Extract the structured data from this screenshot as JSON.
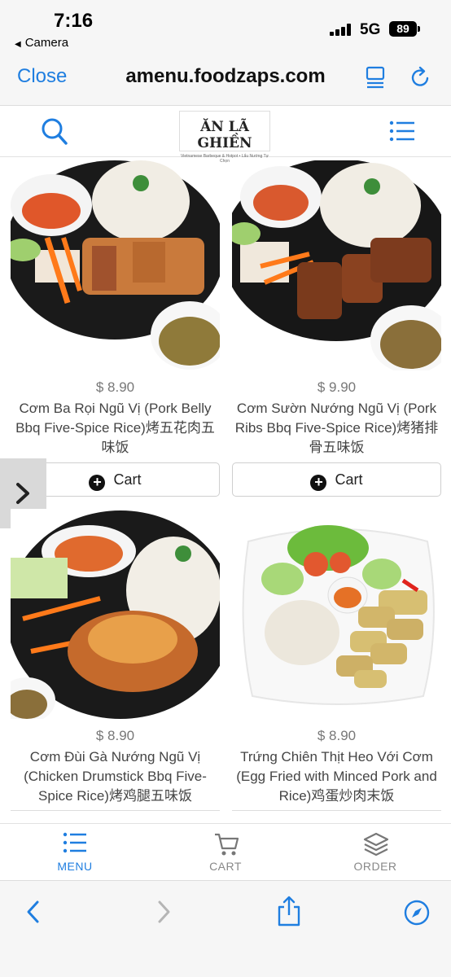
{
  "status_bar": {
    "time": "7:16",
    "back_label": "Camera",
    "network": "5G",
    "battery": "89"
  },
  "browser": {
    "close_label": "Close",
    "url": "amenu.foodzaps.com"
  },
  "header": {
    "logo_text": "ĂN LÃ GHIỀN",
    "logo_tagline": "Vietnamese Barbeque & Hotpot • Lẩu Nướng Tự Chọn"
  },
  "colors": {
    "accent": "#1f7ee0",
    "tab_inactive": "#888888"
  },
  "menu_items": [
    {
      "price": "$ 8.90",
      "name": "Cơm Ba Rọi Ngũ Vị (Pork Belly Bbq Five-Spice Rice)烤五花肉五味饭",
      "cart_label": "Cart"
    },
    {
      "price": "$ 9.90",
      "name": "Cơm Sườn Nướng Ngũ Vị (Pork Ribs Bbq Five-Spice Rice)烤猪排骨五味饭",
      "cart_label": "Cart"
    },
    {
      "price": "$ 8.90",
      "name": "Cơm Đùi Gà Nướng Ngũ Vị (Chicken Drumstick Bbq Five-Spice Rice)烤鸡腿五味饭"
    },
    {
      "price": "$ 8.90",
      "name": "Trứng Chiên Thịt Heo Với Cơm (Egg Fried with Minced Pork and Rice)鸡蛋炒肉末饭"
    }
  ],
  "tabs": [
    {
      "label": "MENU",
      "icon": "menu-list-icon",
      "active": true
    },
    {
      "label": "CART",
      "icon": "cart-icon",
      "active": false
    },
    {
      "label": "ORDER",
      "icon": "layers-icon",
      "active": false
    }
  ],
  "toolbar_icons": [
    "back-arrow-icon",
    "forward-arrow-icon",
    "share-icon",
    "compass-icon"
  ]
}
